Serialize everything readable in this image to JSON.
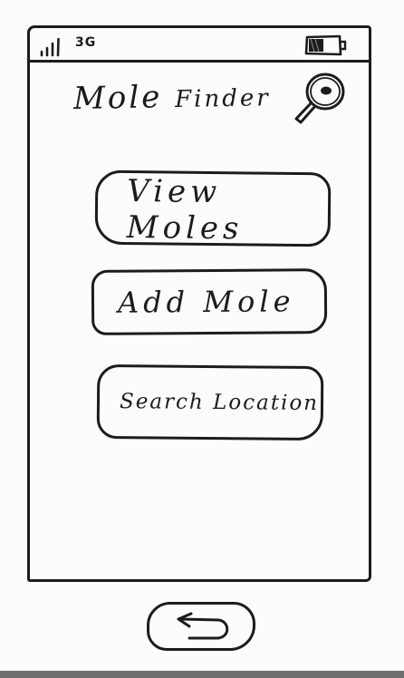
{
  "status_bar": {
    "network": "3G",
    "signal_icon": "signal-bars-icon",
    "battery_icon": "battery-icon",
    "battery_level": 0.5
  },
  "header": {
    "title_first": "Mole",
    "title_second": "Finder",
    "search_icon": "magnifying-glass-icon"
  },
  "menu": {
    "view_moles_label": "View Moles",
    "add_mole_label": "Add Mole",
    "search_location_label": "Search Location"
  },
  "navigation": {
    "back_icon": "back-arrow-icon"
  },
  "colors": {
    "ink": "#1c1c1c",
    "paper": "#fcfcfc"
  }
}
